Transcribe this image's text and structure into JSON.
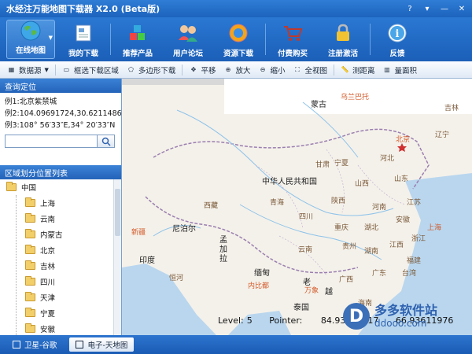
{
  "app": {
    "title": "水经注万能地图下载器 X2.0 (Beta版)"
  },
  "toolbar": {
    "items": [
      {
        "label": "在线地图",
        "icon": "globe-icon"
      },
      {
        "label": "我的下载",
        "icon": "document-icon"
      },
      {
        "label": "推荐产品",
        "icon": "cubes-icon"
      },
      {
        "label": "用户论坛",
        "icon": "users-icon"
      },
      {
        "label": "资源下载",
        "icon": "ie-globe-icon"
      },
      {
        "label": "付费购买",
        "icon": "shopping-cart-icon"
      },
      {
        "label": "注册激活",
        "icon": "lock-icon"
      },
      {
        "label": "反馈",
        "icon": "info-icon"
      }
    ]
  },
  "maptools": {
    "datasource": "数据源",
    "rect_download": "框选下载区域",
    "polygon_download": "多边形下载",
    "pan": "平移",
    "zoom_in": "放大",
    "zoom_out": "缩小",
    "full_view": "全视图",
    "measure_distance": "测距离",
    "measure_area": "量面积"
  },
  "query": {
    "header": "查询定位",
    "example1": "例1:北京紫禁城",
    "example2": "例2:104.09691724,30.62114865",
    "example3": "例3:108° 56′33″E,34° 20′33″N",
    "input_value": ""
  },
  "tree": {
    "header": "区域划分位置列表",
    "root": "中国",
    "children": [
      "上海",
      "云南",
      "内蒙古",
      "北京",
      "吉林",
      "四川",
      "天津",
      "宁夏",
      "安徽"
    ]
  },
  "map": {
    "labels": {
      "mongolia": "蒙古",
      "ulaanbaatar": "乌兰巴托",
      "china": "中华人民共和国",
      "beijing": "北京",
      "liaoning": "辽宁",
      "xinjiang": "新疆",
      "nepal": "尼泊尔",
      "india": "印度",
      "bangladesh": "孟加拉",
      "myanmar": "缅甸",
      "laos": "老",
      "thailand": "泰国",
      "tibet": "西藏",
      "qinghai": "青海",
      "sichuan": "四川",
      "yunnan": "云南",
      "guangxi": "广西",
      "guangdong": "广东",
      "hebei": "河北",
      "henan": "河南",
      "shandong": "山东",
      "jiangsu": "江苏",
      "hubei": "湖北",
      "hunan": "湖南",
      "fujian": "福建",
      "taiwan": "台湾",
      "jilin": "吉林",
      "gansu": "甘肃",
      "shanxi": "山西",
      "shaanxi": "陕西",
      "ningxia": "宁夏",
      "chongqing": "重庆",
      "guizhou": "贵州",
      "jiangxi": "江西",
      "zhejiang": "浙江",
      "anhui": "安徽",
      "shanghai": "上海",
      "hainan": "海南",
      "vientiane": "万象",
      "yue": "越",
      "naypyidaw": "内比都",
      "ganges": "恒河"
    },
    "level_label": "Level:",
    "level_value": "5",
    "pointer_label": "Pointer:",
    "pointer_x": "84.93158417",
    "pointer_y": "66.93611976"
  },
  "watermark": {
    "brand": "多多软件站",
    "url": "ddooo.com",
    "logo_letter": "D"
  },
  "bottombar": {
    "tab1": "卫星-谷歌",
    "tab2": "电子-天地图"
  },
  "colors": {
    "toolbar_blue": "#1e63bb",
    "map_land": "#f4f1ea",
    "map_water": "#b9d6ee"
  }
}
